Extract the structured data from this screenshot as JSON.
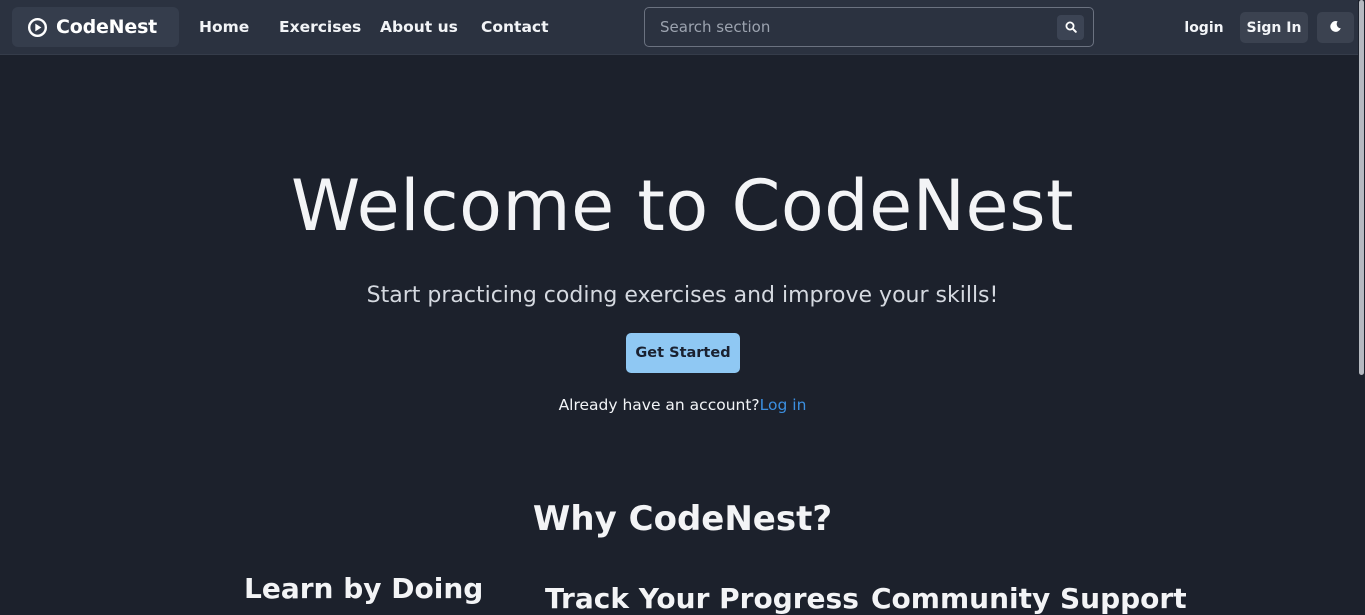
{
  "navbar": {
    "brand_name": "CodeNest",
    "brand_icon": "play-circle-icon",
    "links": [
      "Home",
      "Exercises",
      "About us",
      "Contact"
    ],
    "search_placeholder": "Search section",
    "search_icon": "search-icon",
    "login_label": "login",
    "signin_label": "Sign In",
    "theme_icon": "moon-icon"
  },
  "hero": {
    "title": "Welcome to CodeNest",
    "subtitle": "Start practicing coding exercises and improve your skills!",
    "cta_label": "Get Started",
    "account_text": "Already have an account?",
    "account_link": "Log in"
  },
  "why": {
    "title": "Why CodeNest?",
    "features": [
      "Learn by Doing",
      "Track Your Progress",
      "Community Support"
    ]
  },
  "colors": {
    "background": "#1c212c",
    "navbar": "#2b3240",
    "cta": "#8fc8f3",
    "link": "#3b8fe0"
  }
}
